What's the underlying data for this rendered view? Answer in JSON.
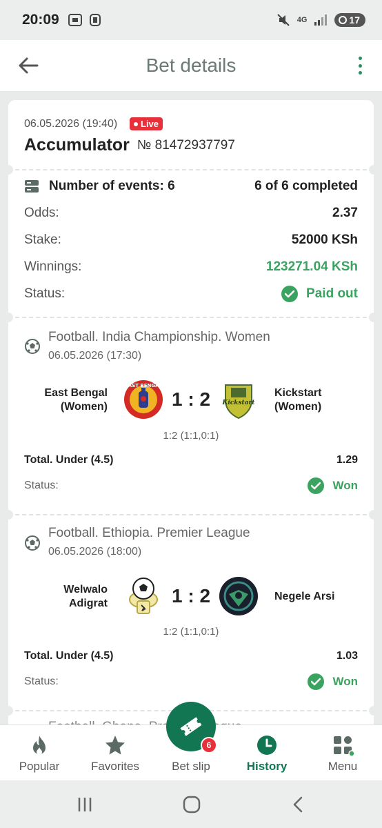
{
  "status_bar": {
    "time": "20:09",
    "battery": "17",
    "network": "4G"
  },
  "app_bar": {
    "title": "Bet details"
  },
  "bet": {
    "date": "06.05.2026 (19:40)",
    "live_label": "Live",
    "type": "Accumulator",
    "number": "№ 81472937797",
    "events_label": "Number of events: 6",
    "completed": "6 of 6 completed",
    "odds_label": "Odds:",
    "odds": "2.37",
    "stake_label": "Stake:",
    "stake": "52000 KSh",
    "winnings_label": "Winnings:",
    "winnings": "123271.04 KSh",
    "status_label": "Status:",
    "status": "Paid out"
  },
  "events": [
    {
      "league": "Football. India Championship. Women",
      "date": "06.05.2026 (17:30)",
      "home_line1": "East Bengal",
      "home_line2": "(Women)",
      "away_line1": "Kickstart",
      "away_line2": "(Women)",
      "score": "1 : 2",
      "score_detail": "1:2 (1:1,0:1)",
      "market": "Total. Under (4.5)",
      "odds": "1.29",
      "status_label": "Status:",
      "status": "Won",
      "home_logo_text": "EAST BENGAL",
      "away_logo_text": "Kickstart"
    },
    {
      "league": "Football. Ethiopia. Premier League",
      "date": "06.05.2026 (18:00)",
      "home_line1": "Welwalo",
      "home_line2": "Adigrat",
      "away_line1": "Negele Arsi",
      "away_line2": "",
      "score": "1 : 2",
      "score_detail": "1:2 (1:1,0:1)",
      "market": "Total. Under (4.5)",
      "odds": "1.03",
      "status_label": "Status:",
      "status": "Won"
    }
  ],
  "next_event_peek": "Football. Ghana. Premier League",
  "bottom_nav": {
    "popular": "Popular",
    "favorites": "Favorites",
    "betslip": "Bet slip",
    "betslip_count": "6",
    "history": "History",
    "menu": "Menu"
  },
  "colors": {
    "accent": "#137653",
    "success": "#3aa35f",
    "live": "#e8303a"
  }
}
